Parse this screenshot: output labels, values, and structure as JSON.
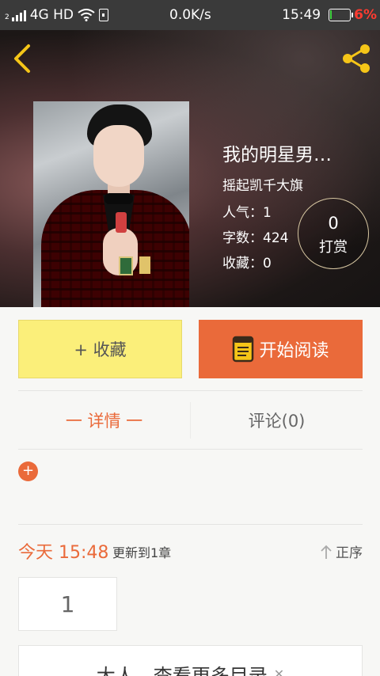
{
  "status_bar": {
    "sim": "2",
    "network": "4G HD",
    "speed": "0.0K/s",
    "time": "15:49",
    "battery": "6%",
    "battery_color": "#ff3b30"
  },
  "header": {
    "back_icon": "chevron-left-icon",
    "share_icon": "share-icon",
    "accent_color": "#f5c518"
  },
  "book": {
    "title": "我的明星男…",
    "author": "摇起凯千大旗",
    "popularity": "人气：1",
    "word_count": "字数：424",
    "favorites": "收藏：0",
    "reward_count": "0",
    "reward_label": "打赏"
  },
  "actions": {
    "collect_label": "+ 收藏",
    "read_label": "开始阅读",
    "collect_color": "#fbef7a",
    "read_color": "#ea6a3a"
  },
  "tabs": {
    "details": "一 详情 一",
    "comments": "评论(0)"
  },
  "expand_symbol": "+",
  "update": {
    "time": "今天 15:48",
    "text": "更新到1章",
    "sort_label": "正序"
  },
  "chapters": {
    "items": [
      "1"
    ],
    "more_label": "大人，查看更多目录"
  }
}
